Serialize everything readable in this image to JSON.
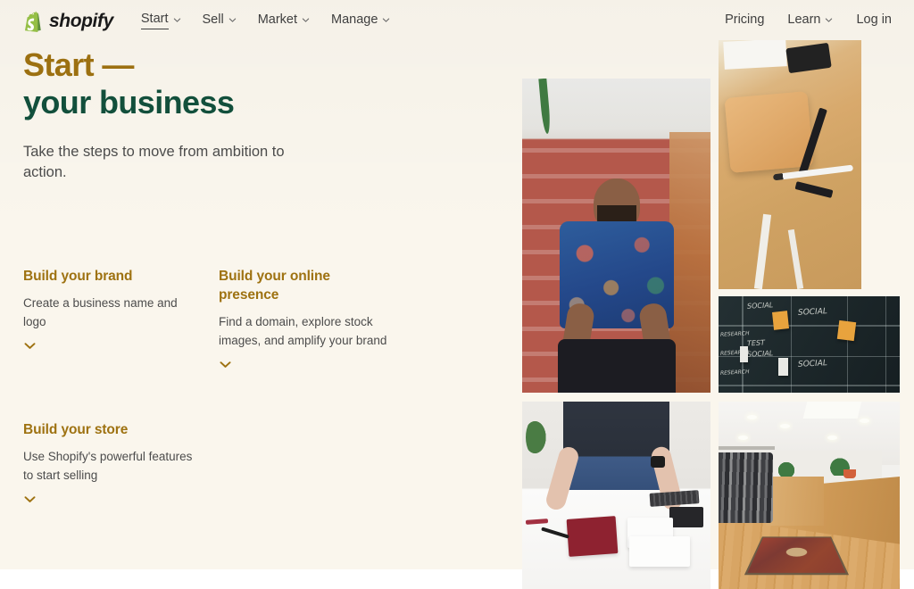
{
  "brand": {
    "name": "shopify",
    "logo_icon": "shopify-bag-icon",
    "logo_color": "#95bf46"
  },
  "colors": {
    "background": "#faf6ed",
    "heading_gold": "#9e7211",
    "heading_green": "#12503c",
    "body_text": "#4c4c4c",
    "nav_text": "#3f3f3f",
    "chevron_gold": "#9e7211"
  },
  "nav": {
    "primary": [
      {
        "label": "Start",
        "has_dropdown": true,
        "active": true,
        "icon": "chevron-down-icon"
      },
      {
        "label": "Sell",
        "has_dropdown": true,
        "active": false,
        "icon": "chevron-down-icon"
      },
      {
        "label": "Market",
        "has_dropdown": true,
        "active": false,
        "icon": "chevron-down-icon"
      },
      {
        "label": "Manage",
        "has_dropdown": true,
        "active": false,
        "icon": "chevron-down-icon"
      }
    ],
    "secondary": [
      {
        "label": "Pricing",
        "has_dropdown": false,
        "active": false
      },
      {
        "label": "Learn",
        "has_dropdown": true,
        "active": false,
        "icon": "chevron-down-icon"
      },
      {
        "label": "Log in",
        "has_dropdown": false,
        "active": false
      }
    ]
  },
  "hero": {
    "title_line1": "Start —",
    "title_line2": "your business",
    "subtitle": "Take the steps to move from ambition to action."
  },
  "features": [
    {
      "title": "Build your brand",
      "description": "Create a business name and logo",
      "expand_icon": "chevron-down-icon"
    },
    {
      "title": "Build your online presence",
      "description": "Find a domain, explore stock images, and amplify your brand",
      "expand_icon": "chevron-down-icon"
    },
    {
      "title": "Build your store",
      "description": "Use Shopify's powerful features to start selling",
      "expand_icon": "chevron-down-icon"
    }
  ],
  "gallery": [
    {
      "alt": "Bearded man in floral shirt sitting on red stairs"
    },
    {
      "alt": "Wooden desk with leather goods, carpenter square and marker"
    },
    {
      "alt": "Chalkboard planning grid with handwritten notes and sticky notes"
    },
    {
      "alt": "Person arranging notebooks and stationery on a white desk"
    },
    {
      "alt": "Retail clothing store interior with wooden counter and rug"
    }
  ],
  "chalkboard_notes": [
    "SOCIAL",
    "SOCIAL",
    "TEST",
    "SOCIAL",
    "SOCIAL",
    "RESEARCH"
  ]
}
